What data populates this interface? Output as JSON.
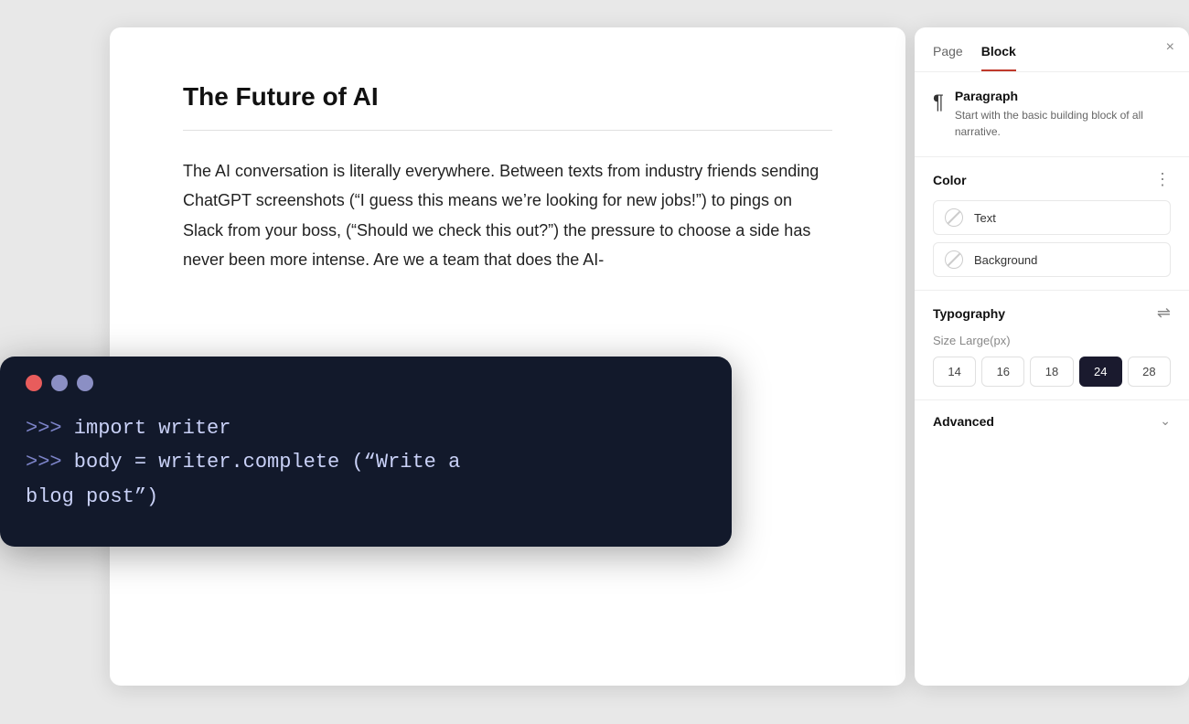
{
  "editor": {
    "title": "The Future of AI",
    "body_text": "The AI conversation is literally everywhere. Between texts from industry friends sending ChatGPT screenshots (“I guess this means we’re looking for new jobs!”) to pings on Slack from your boss, (“Should we check this out?”) the pressure to choose a side has never been more intense. Are we a team that does the AI-"
  },
  "terminal": {
    "line1": ">>> import writer",
    "line2": ">>> body = writer.complete (“Write a",
    "line3": "blog post”)"
  },
  "panel": {
    "tab_page": "Page",
    "tab_block": "Block",
    "close_label": "×",
    "block": {
      "icon": "¶",
      "title": "Paragraph",
      "description": "Start with the basic building block of all narrative."
    },
    "color_section": {
      "title": "Color",
      "text_label": "Text",
      "background_label": "Background"
    },
    "typography_section": {
      "title": "Typography",
      "size_label": "Size",
      "size_value": "Large(px)",
      "sizes": [
        "14",
        "16",
        "18",
        "24",
        "28"
      ],
      "active_size": "24"
    },
    "advanced_section": {
      "title": "Advanced"
    }
  }
}
